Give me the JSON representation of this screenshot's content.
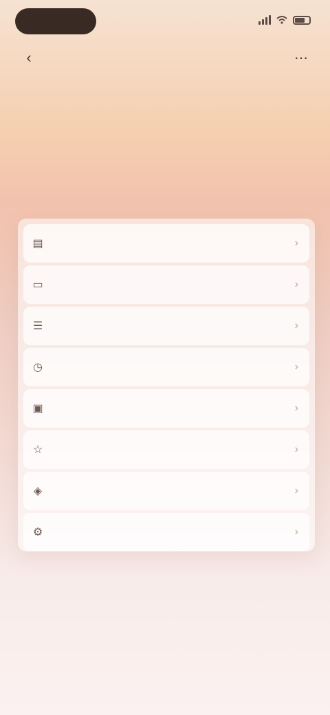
{
  "status_bar": {
    "time": "",
    "icons": [
      "signal-icon",
      "wifi-icon",
      "battery-icon"
    ]
  },
  "nav": {
    "back_icon": "back-arrow-icon",
    "title": "",
    "more_icon": "more-icon"
  },
  "heading": "",
  "menu": {
    "items": [
      {
        "icon": "document-icon",
        "label": ""
      },
      {
        "icon": "folder-icon",
        "label": ""
      },
      {
        "icon": "list-icon",
        "label": ""
      },
      {
        "icon": "clock-icon",
        "label": ""
      },
      {
        "icon": "image-icon",
        "label": ""
      },
      {
        "icon": "star-icon",
        "label": ""
      },
      {
        "icon": "tag-icon",
        "label": ""
      },
      {
        "icon": "settings-icon",
        "label": ""
      }
    ]
  },
  "colors": {
    "accent_dark": "#3a2a24",
    "background_top": "#f6e2d2",
    "background_peach": "#f5d0b0",
    "background_bottom": "#fbf1f0"
  }
}
